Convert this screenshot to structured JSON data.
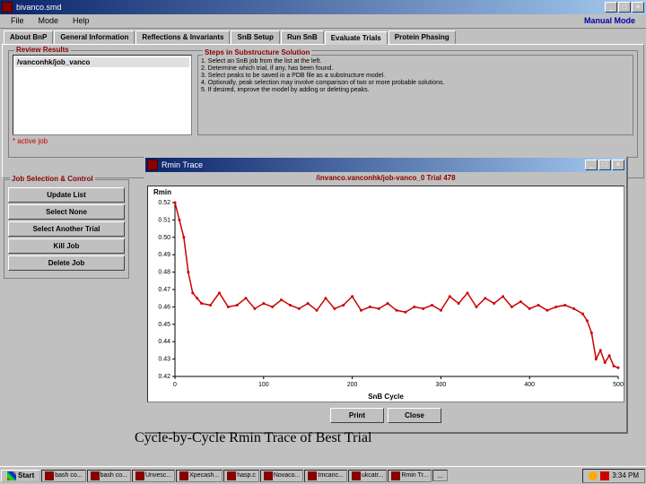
{
  "window": {
    "title": "bivanco.smd",
    "menu": [
      "File",
      "Mode",
      "Help"
    ],
    "manual": "Manual Mode"
  },
  "tabs": [
    "About BnP",
    "General Information",
    "Reflections & Invariants",
    "SnB Setup",
    "Run SnB",
    "Evaluate Trials",
    "Protein Phasing"
  ],
  "review": {
    "title": "Review Results",
    "joblist_hdr": "/vanconhk/job_vanco",
    "active": "* active job",
    "steps_title": "Steps in Substructure Solution",
    "steps": [
      "1. Select an SnB job from the list at the left.",
      "2. Determine which trial, if any, has been found.",
      "3. Select peaks to be saved in a PDB file as a substructure model.",
      "4. Optionally, peak selection may involve comparison of two or more probable solutions.",
      "5. If desired, improve the model by adding or deleting peaks."
    ]
  },
  "jobsel": {
    "title": "Job Selection & Control",
    "btns": [
      "Update List",
      "Select None",
      "Select Another Trial",
      "Kill Job",
      "Delete Job"
    ]
  },
  "trace": {
    "title": "Rmin Trace",
    "path": "/invanco.vanconhk/job-vanco_0 Trial 478",
    "chart_title": "Rmin",
    "xlabel": "SnB Cycle",
    "btns": [
      "Print",
      "Close"
    ]
  },
  "caption": "Cycle-by-Cycle Rmin Trace of Best Trial",
  "taskbar": {
    "start": "Start",
    "items": [
      "bash co...",
      "bash co...",
      "Unvesc...",
      "Xpecash...",
      "hasp.c",
      "Novaco...",
      "tmcanc...",
      "ukcatr...",
      "Rmin Tr..."
    ],
    "tray": "...",
    "clock": "3:34 PM"
  },
  "chart_data": {
    "type": "line",
    "xlabel": "SnB Cycle",
    "ylabel": "Rmin",
    "xlim": [
      0,
      500
    ],
    "ylim": [
      0.42,
      0.52
    ],
    "yticks": [
      0.42,
      0.43,
      0.44,
      0.45,
      0.46,
      0.47,
      0.48,
      0.49,
      0.5,
      0.51,
      0.52
    ],
    "xticks": [
      0,
      100,
      200,
      300,
      400,
      500
    ],
    "series": [
      {
        "name": "Rmin",
        "color": "#c00",
        "x": [
          0,
          5,
          10,
          15,
          20,
          25,
          30,
          40,
          50,
          60,
          70,
          80,
          90,
          100,
          110,
          120,
          130,
          140,
          150,
          160,
          170,
          180,
          190,
          200,
          210,
          220,
          230,
          240,
          250,
          260,
          270,
          280,
          290,
          300,
          310,
          320,
          330,
          340,
          350,
          360,
          370,
          380,
          390,
          400,
          410,
          420,
          430,
          440,
          450,
          460,
          465,
          470,
          475,
          480,
          485,
          490,
          495,
          500
        ],
        "y": [
          0.52,
          0.51,
          0.5,
          0.48,
          0.468,
          0.465,
          0.462,
          0.461,
          0.468,
          0.46,
          0.461,
          0.465,
          0.459,
          0.462,
          0.46,
          0.464,
          0.461,
          0.459,
          0.462,
          0.458,
          0.465,
          0.459,
          0.461,
          0.466,
          0.458,
          0.46,
          0.459,
          0.462,
          0.458,
          0.457,
          0.46,
          0.459,
          0.461,
          0.458,
          0.466,
          0.462,
          0.468,
          0.46,
          0.465,
          0.462,
          0.466,
          0.46,
          0.463,
          0.459,
          0.461,
          0.458,
          0.46,
          0.461,
          0.459,
          0.456,
          0.452,
          0.445,
          0.43,
          0.435,
          0.428,
          0.432,
          0.426,
          0.425
        ]
      }
    ]
  }
}
